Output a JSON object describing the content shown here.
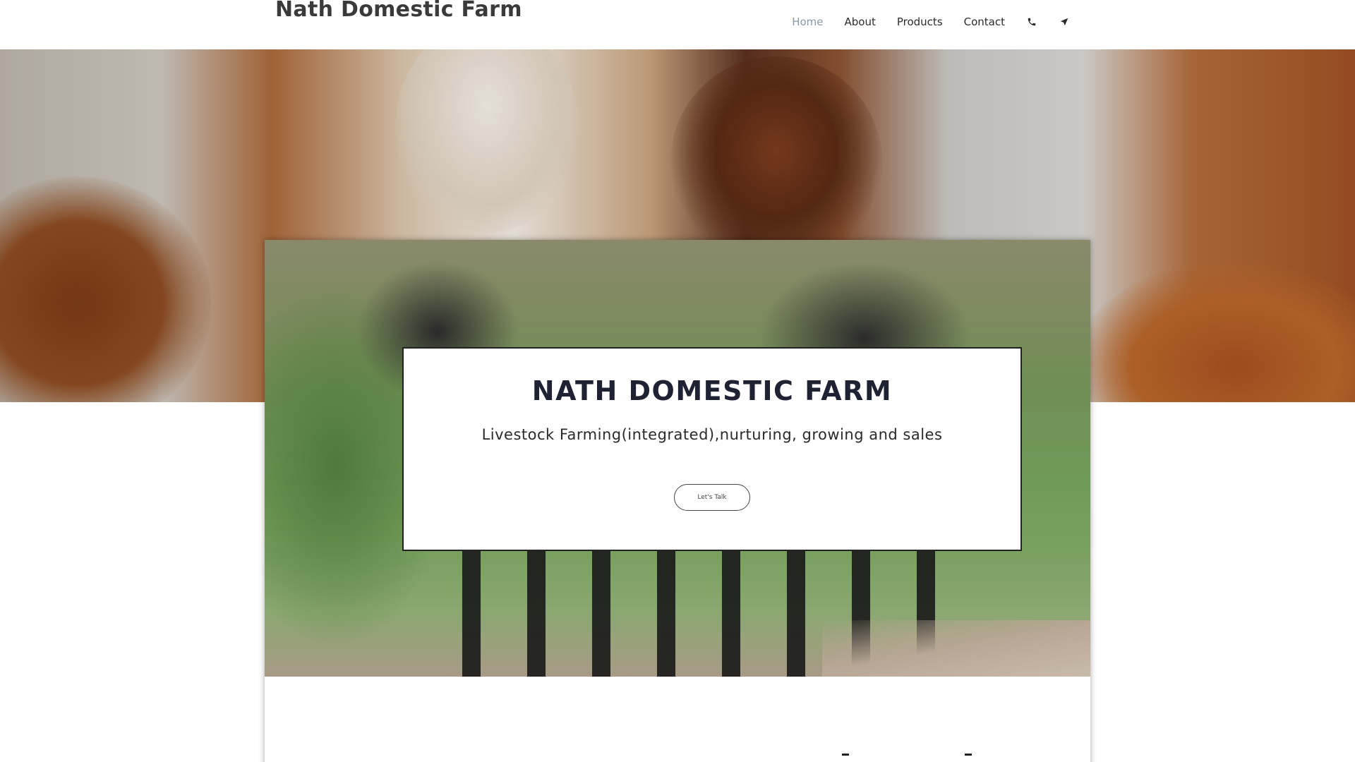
{
  "header": {
    "site_title": "Nath Domestic Farm",
    "nav": [
      {
        "label": "Home",
        "active": true
      },
      {
        "label": "About",
        "active": false
      },
      {
        "label": "Products",
        "active": false
      },
      {
        "label": "Contact",
        "active": false
      }
    ],
    "icons": [
      "phone-icon",
      "location-arrow-icon"
    ]
  },
  "hero": {
    "heading": "NATH DOMESTIC FARM",
    "subheading": "Livestock Farming(integrated),nurturing, growing and sales",
    "cta_label": "Let's Talk"
  },
  "colors": {
    "nav_active": "#8a9aa8",
    "heading": "#1f2233",
    "text": "#2b2b2b"
  }
}
